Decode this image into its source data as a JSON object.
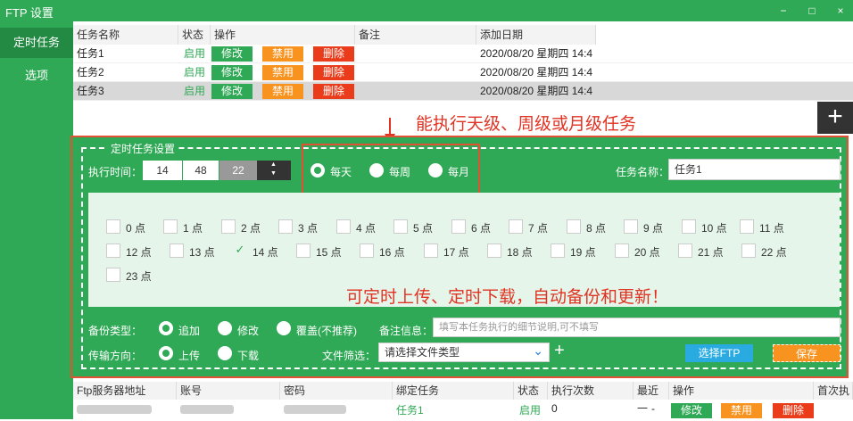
{
  "window": {
    "title": "FTP 设置",
    "minimize": "−",
    "maximize": "□",
    "close": "×"
  },
  "sidebar": {
    "items": [
      {
        "label": "定时任务"
      },
      {
        "label": "选项"
      }
    ]
  },
  "task_table": {
    "headers": [
      "任务名称",
      "状态",
      "操作",
      "备注",
      "添加日期"
    ],
    "rows": [
      {
        "name": "任务1",
        "status": "启用",
        "edit": "修改",
        "disable": "禁用",
        "delete": "删除",
        "note": "",
        "date": "2020/08/20 星期四 14:4"
      },
      {
        "name": "任务2",
        "status": "启用",
        "edit": "修改",
        "disable": "禁用",
        "delete": "删除",
        "note": "",
        "date": "2020/08/20 星期四 14:4"
      },
      {
        "name": "任务3",
        "status": "启用",
        "edit": "修改",
        "disable": "禁用",
        "delete": "删除",
        "note": "",
        "date": "2020/08/20 星期四 14:4"
      }
    ]
  },
  "add_icon": "+",
  "annotations": {
    "top": "能执行天级、周级或月级任务",
    "middle": "可定时上传、定时下载，自动备份和更新！"
  },
  "settings": {
    "legend": "定时任务设置",
    "exec_time_label": "执行时间：",
    "hour": "14",
    "minute": "48",
    "second": "22",
    "spin_up": "▲",
    "spin_down": "▼",
    "freq": [
      {
        "label": "每天",
        "checked": true
      },
      {
        "label": "每周",
        "checked": false
      },
      {
        "label": "每月",
        "checked": false
      }
    ],
    "task_name_label": "任务名称：",
    "task_name_value": "任务1",
    "hours": [
      "0 点",
      "1 点",
      "2 点",
      "3 点",
      "4 点",
      "5 点",
      "6 点",
      "7 点",
      "8 点",
      "9 点",
      "10 点",
      "11 点",
      "12 点",
      "13 点",
      "14 点",
      "15 点",
      "16 点",
      "17 点",
      "18 点",
      "19 点",
      "20 点",
      "21 点",
      "22 点",
      "23 点"
    ],
    "checked_hour": 14,
    "check_mark": "✓",
    "backup_type_label": "备份类型：",
    "backup_types": [
      {
        "label": "追加",
        "checked": true
      },
      {
        "label": "修改",
        "checked": false
      },
      {
        "label": "覆盖(不推荐)",
        "checked": false
      }
    ],
    "note_label": "备注信息：",
    "note_placeholder": "填写本任务执行的细节说明,可不填写",
    "direction_label": "传输方向：",
    "directions": [
      {
        "label": "上传",
        "checked": true
      },
      {
        "label": "下载",
        "checked": false
      }
    ],
    "file_filter_label": "文件筛选：",
    "file_filter_value": "请选择文件类型",
    "dropdown_icon": "⌄",
    "add_filter": "+",
    "select_ftp": "选择FTP",
    "save": "保存"
  },
  "server_table": {
    "headers": [
      "Ftp服务器地址",
      "账号",
      "密码",
      "绑定任务",
      "状态",
      "执行次数",
      "最近一",
      "操作",
      "首次执行"
    ],
    "row": {
      "bound_task": "任务1",
      "status": "启用",
      "count": "0",
      "last": "-",
      "edit": "修改",
      "disable": "禁用",
      "delete": "删除"
    }
  }
}
